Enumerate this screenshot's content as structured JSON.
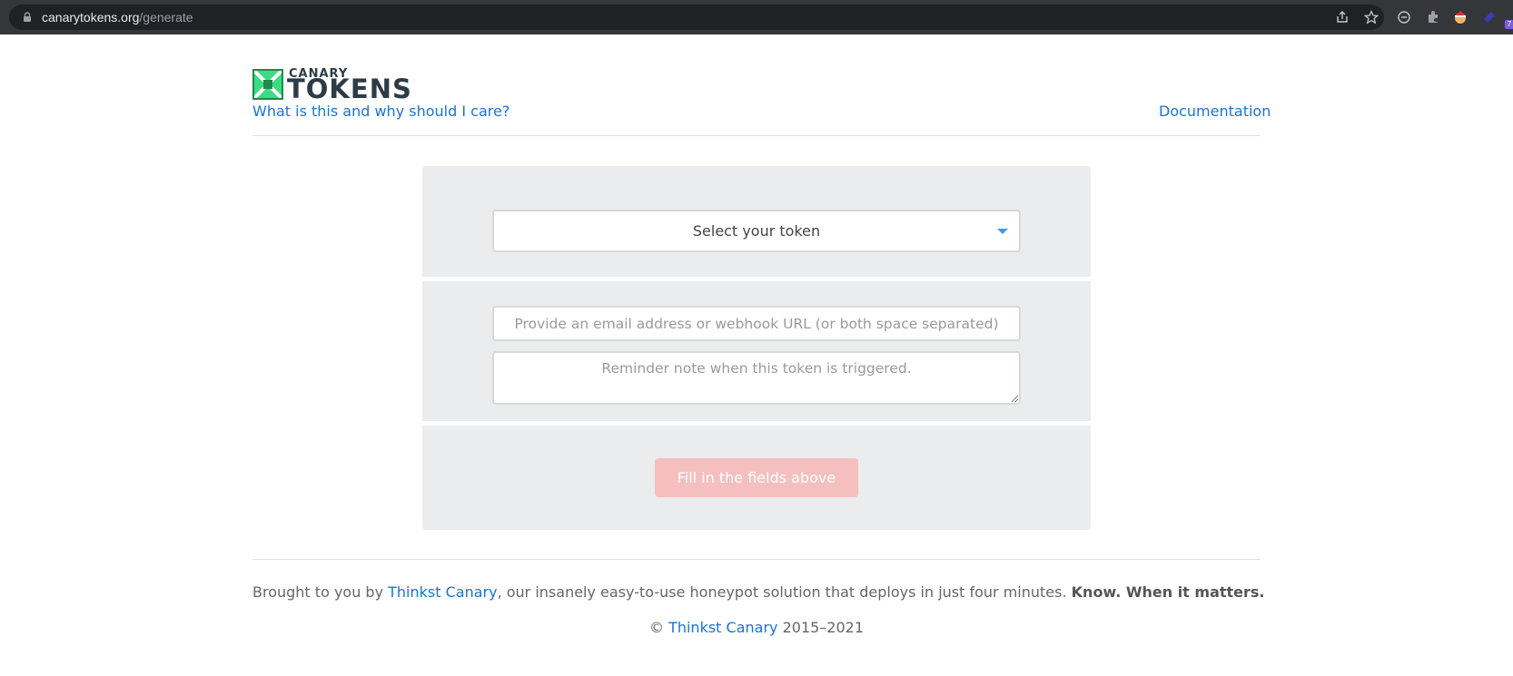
{
  "browser": {
    "url_host": "canarytokens.org",
    "url_path": "/generate",
    "extension_badge": "7"
  },
  "header": {
    "logo_top": "CANARY",
    "logo_bottom": "TOKENS",
    "what_link": "What is this and why should I care?",
    "doc_link": "Documentation"
  },
  "form": {
    "select_label": "Select your token",
    "email_placeholder": "Provide an email address or webhook URL (or both space separated)",
    "note_placeholder": "Reminder note when this token is triggered.",
    "submit_label": "Fill in the fields above"
  },
  "footer": {
    "brought_prefix": "Brought to you by ",
    "brought_link": "Thinkst Canary",
    "brought_suffix": ", our insanely easy-to-use honeypot solution that deploys in just four minutes. ",
    "brought_bold": "Know. When it matters.",
    "copyright_symbol": "© ",
    "copyright_link": "Thinkst Canary",
    "copyright_years": " 2015–2021"
  },
  "colors": {
    "accent_link": "#1a73d9",
    "logo_green": "#3ddc84",
    "logo_dark": "#2d3b45",
    "submit_disabled": "#f5bfbf"
  }
}
